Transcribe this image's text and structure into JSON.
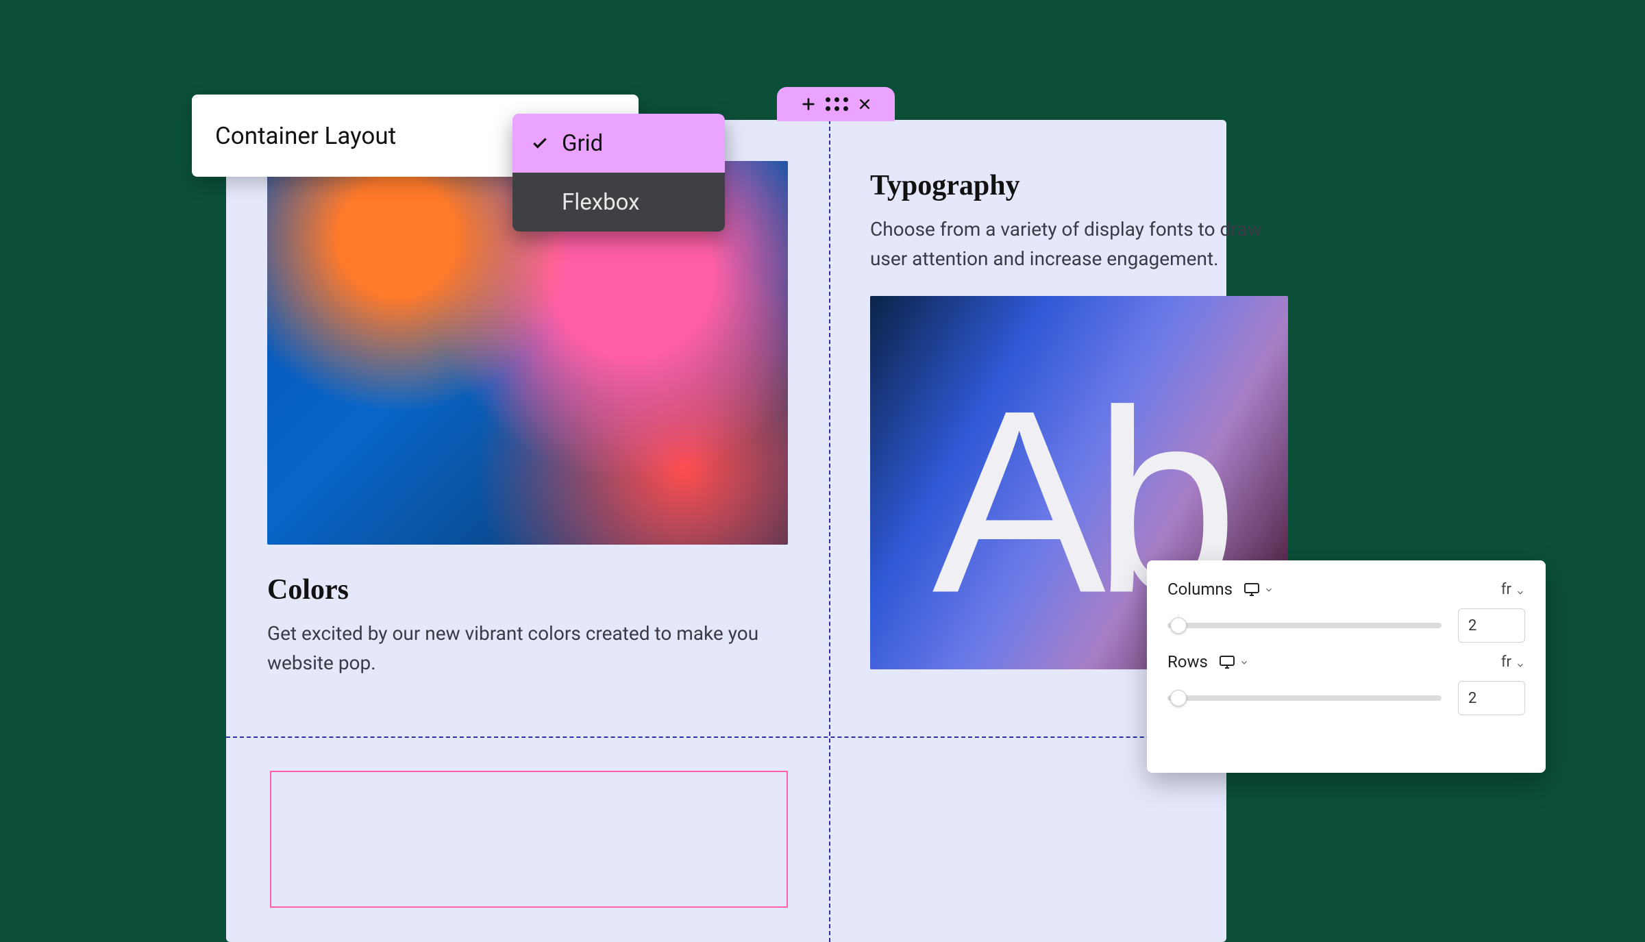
{
  "layoutPopover": {
    "title": "Container Layout",
    "options": [
      {
        "label": "Grid",
        "selected": true
      },
      {
        "label": "Flexbox",
        "selected": false
      }
    ]
  },
  "sectionTab": {
    "addIcon": "plus-icon",
    "dragIcon": "drag-handle-icon",
    "closeIcon": "close-icon"
  },
  "cells": {
    "colors": {
      "title": "Colors",
      "body": "Get excited by our new vibrant colors created to make you website pop."
    },
    "typography": {
      "title": "Typography",
      "body": "Choose from a variety of display fonts to draw user attention and increase engagement.",
      "sampleText": "Ab"
    }
  },
  "gridControls": {
    "columns": {
      "label": "Columns",
      "unit": "fr",
      "value": "2"
    },
    "rows": {
      "label": "Rows",
      "unit": "fr",
      "value": "2"
    }
  }
}
